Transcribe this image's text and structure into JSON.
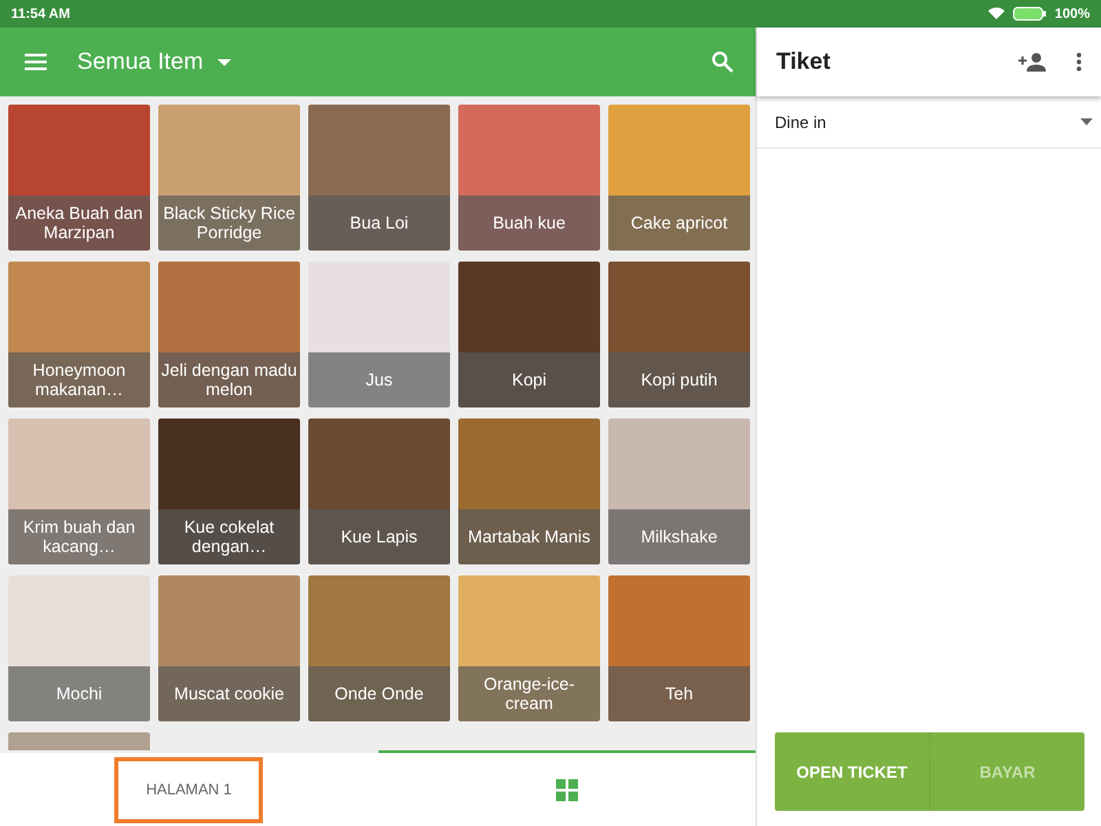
{
  "status_bar": {
    "time": "11:54 AM",
    "battery": "100%"
  },
  "toolbar": {
    "title": "Semua Item"
  },
  "items": [
    {
      "kind": "tile",
      "label": "Aneka Buah dan Marzipan"
    },
    {
      "kind": "tile",
      "label": "Black Sticky Rice Porridge"
    },
    {
      "kind": "tile",
      "label": "Bua Loi"
    },
    {
      "kind": "tile",
      "label": "Buah kue"
    },
    {
      "kind": "tile",
      "label": "Cake apricot"
    },
    {
      "kind": "tile",
      "label": "Honeymoon makanan…"
    },
    {
      "kind": "tile",
      "label": "Jeli dengan madu melon"
    },
    {
      "kind": "tile",
      "label": "Jus"
    },
    {
      "kind": "tile",
      "label": "Kopi"
    },
    {
      "kind": "tile",
      "label": "Kopi putih"
    },
    {
      "kind": "tile",
      "label": "Krim buah dan kacang…"
    },
    {
      "kind": "tile",
      "label": "Kue cokelat dengan…"
    },
    {
      "kind": "tile",
      "label": "Kue Lapis"
    },
    {
      "kind": "tile",
      "label": "Martabak Manis"
    },
    {
      "kind": "tile",
      "label": "Milkshake"
    },
    {
      "kind": "tile",
      "label": "Mochi"
    },
    {
      "kind": "tile",
      "label": "Muscat cookie"
    },
    {
      "kind": "tile",
      "label": "Onde Onde"
    },
    {
      "kind": "tile",
      "label": "Orange-ice-cream"
    },
    {
      "kind": "tile",
      "label": "Teh"
    },
    {
      "kind": "cut"
    }
  ],
  "bottom_tabs": [
    {
      "kind": "text",
      "label": "HALAMAN 1",
      "selected": false,
      "highlighted": true
    },
    {
      "kind": "grid",
      "selected": true,
      "highlighted": false
    }
  ],
  "ticket": {
    "title": "Tiket",
    "dining_option": "Dine in",
    "buttons": [
      {
        "label": "OPEN TICKET",
        "disabled": false
      },
      {
        "label": "BAYAR",
        "disabled": true
      }
    ]
  }
}
